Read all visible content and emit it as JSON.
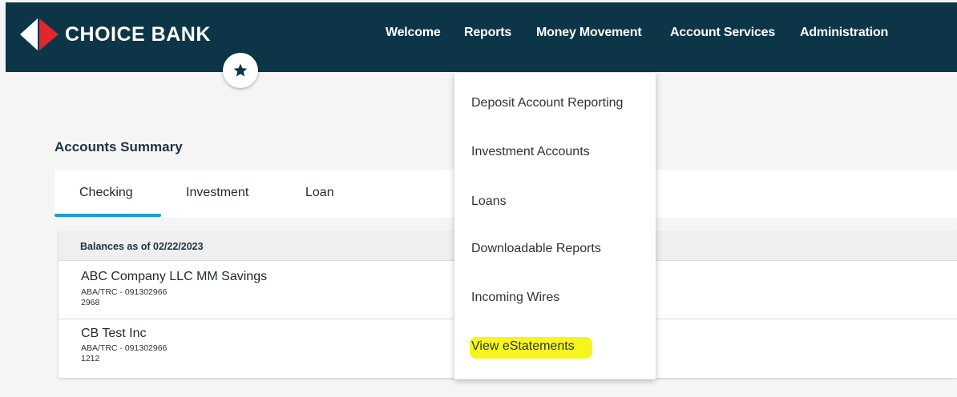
{
  "header": {
    "brand": "CHOICE BANK",
    "brand_color": "#0d3548",
    "logo_accent": "#e0262e",
    "nav": [
      "Welcome",
      "Reports",
      "Money Movement",
      "Account Services",
      "Administration"
    ]
  },
  "favorites_icon": "star-icon",
  "accounts_summary": {
    "title": "Accounts Summary",
    "tabs": [
      "Checking",
      "Investment",
      "Loan"
    ],
    "active_tab": "Checking",
    "balances_header": "Balances as of 02/22/2023",
    "accounts": [
      {
        "name": "ABC Company LLC MM Savings",
        "aba": "ABA/TRC - 091302966",
        "number": "2968"
      },
      {
        "name": "CB Test Inc",
        "aba": "ABA/TRC - 091302966",
        "number": "1212"
      }
    ]
  },
  "reports_menu": {
    "items": [
      "Deposit Account Reporting",
      "Investment Accounts",
      "Loans",
      "Downloadable Reports",
      "Incoming Wires",
      "View eStatements"
    ],
    "highlighted_item": "View eStatements",
    "highlight_color": "#f6f51e"
  }
}
